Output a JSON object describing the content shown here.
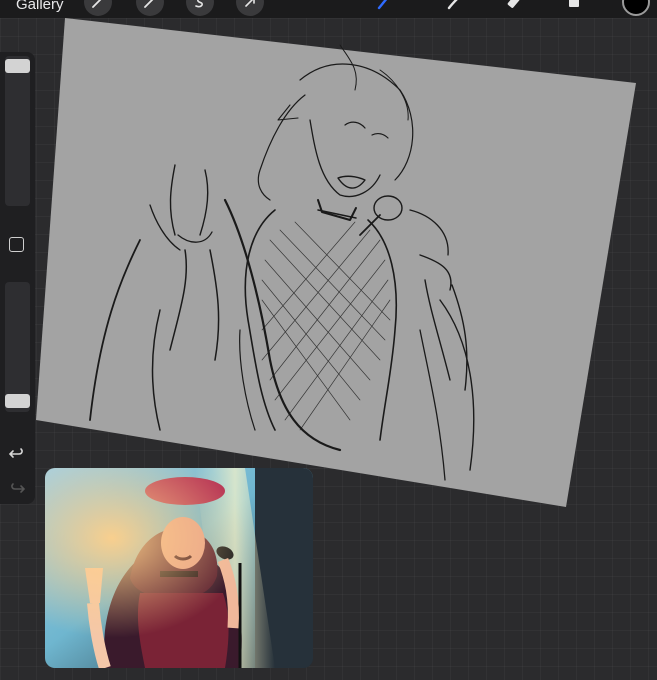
{
  "topbar": {
    "gallery_label": "Gallery",
    "tools": [
      {
        "name": "actions-wrench-icon"
      },
      {
        "name": "adjustments-wand-icon"
      },
      {
        "name": "selection-s-icon"
      },
      {
        "name": "transform-arrow-icon"
      },
      {
        "name": "brush-icon",
        "active": true
      },
      {
        "name": "smudge-icon"
      },
      {
        "name": "eraser-icon"
      },
      {
        "name": "layers-icon"
      }
    ],
    "current_color": "#000000"
  },
  "sidebar": {
    "brush_size_level": 0.03,
    "opacity_level": 0.85
  },
  "colors": {
    "accent": "#2f6bff",
    "sketch_paper": "#a3a3a3",
    "ui_bg": "#2b2b2d"
  }
}
